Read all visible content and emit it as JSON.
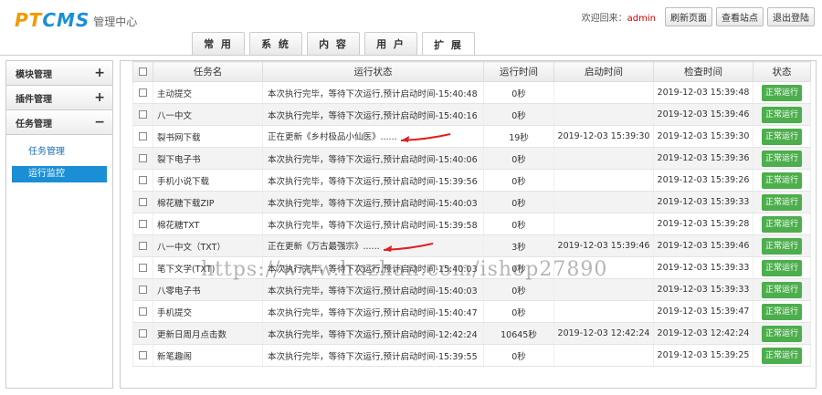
{
  "header": {
    "logo_mark_a": "PT",
    "logo_mark_b": "CMS",
    "logo_sub": "管理中心",
    "welcome_prefix": "欢迎回来：",
    "user": "admin",
    "buttons": [
      "刷新页面",
      "查看站点",
      "退出登陆"
    ],
    "tabs": [
      "常 用",
      "系 统",
      "内 容",
      "用 户",
      "扩 展"
    ],
    "active_tab": 4
  },
  "sidebar": {
    "sections": [
      {
        "label": "模块管理",
        "toggle": "+"
      },
      {
        "label": "插件管理",
        "toggle": "+"
      },
      {
        "label": "任务管理",
        "toggle": "−"
      }
    ],
    "items": [
      {
        "label": "任务管理",
        "active": false
      },
      {
        "label": "运行监控",
        "active": true
      }
    ]
  },
  "table": {
    "columns": [
      "",
      "任务名",
      "运行状态",
      "运行时间",
      "启动时间",
      "检查时间",
      "状态"
    ],
    "rows": [
      {
        "name": "主动提交",
        "status": "本次执行完毕，等待下次运行,预计启动时间-15:40:48",
        "runtime": "0秒",
        "start": "",
        "check": "2019-12-03 15:39:48",
        "state": "正常运行"
      },
      {
        "name": "八一中文",
        "status": "本次执行完毕，等待下次运行,预计启动时间-15:40:16",
        "runtime": "0秒",
        "start": "",
        "check": "2019-12-03 15:39:46",
        "state": "正常运行"
      },
      {
        "name": "裂书网下载",
        "status": "正在更新《乡村极品小仙医》......",
        "runtime": "19秒",
        "start": "2019-12-03 15:39:30",
        "check": "2019-12-03 15:39:30",
        "state": "正常运行",
        "arrow": true
      },
      {
        "name": "裂下电子书",
        "status": "本次执行完毕，等待下次运行,预计启动时间-15:40:06",
        "runtime": "0秒",
        "start": "",
        "check": "2019-12-03 15:39:36",
        "state": "正常运行"
      },
      {
        "name": "手机小说下载",
        "status": "本次执行完毕，等待下次运行,预计启动时间-15:39:56",
        "runtime": "0秒",
        "start": "",
        "check": "2019-12-03 15:39:26",
        "state": "正常运行"
      },
      {
        "name": "棉花糖下载ZIP",
        "status": "本次执行完毕，等待下次运行,预计启动时间-15:40:03",
        "runtime": "0秒",
        "start": "",
        "check": "2019-12-03 15:39:33",
        "state": "正常运行"
      },
      {
        "name": "棉花糖TXT",
        "status": "本次执行完毕，等待下次运行,预计启动时间-15:39:58",
        "runtime": "0秒",
        "start": "",
        "check": "2019-12-03 15:39:28",
        "state": "正常运行"
      },
      {
        "name": "八一中文（TXT）",
        "status": "正在更新《万古最强宗》......",
        "runtime": "3秒",
        "start": "2019-12-03 15:39:46",
        "check": "2019-12-03 15:39:46",
        "state": "正常运行",
        "arrow": true
      },
      {
        "name": "笔下文学(TXT)",
        "status": "本次执行完毕，等待下次运行,预计启动时间-15:40:03",
        "runtime": "0秒",
        "start": "",
        "check": "2019-12-03 15:39:33",
        "state": "正常运行"
      },
      {
        "name": "八零电子书",
        "status": "本次执行完毕，等待下次运行,预计启动时间-15:40:03",
        "runtime": "0秒",
        "start": "",
        "check": "2019-12-03 15:39:33",
        "state": "正常运行"
      },
      {
        "name": "手机提交",
        "status": "本次执行完毕，等待下次运行,预计启动时间-15:40:47",
        "runtime": "0秒",
        "start": "",
        "check": "2019-12-03 15:39:47",
        "state": "正常运行"
      },
      {
        "name": "更新日周月点击数",
        "status": "本次执行完毕，等待下次运行,预计启动时间-12:42:24",
        "runtime": "10645秒",
        "start": "2019-12-03 12:42:24",
        "check": "2019-12-03 12:42:24",
        "state": "正常运行"
      },
      {
        "name": "新笔趣阁",
        "status": "本次执行完毕，等待下次运行,预计启动时间-15:39:55",
        "runtime": "0秒",
        "start": "",
        "check": "2019-12-03 15:39:25",
        "state": "正常运行"
      }
    ]
  },
  "watermark": "https://www.huzhan.com/ishop27890",
  "colors": {
    "logo_orange": "#f39800",
    "logo_blue": "#1a8fd6",
    "run_button": "#4cae4c",
    "active_item": "#1a8fd6",
    "arrow": "#e02020"
  }
}
